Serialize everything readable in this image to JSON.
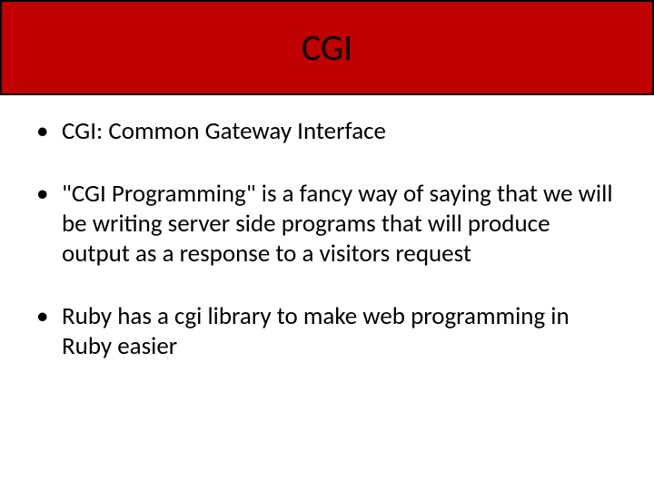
{
  "title": "CGI",
  "bullets": [
    "CGI: Common Gateway Interface",
    "\"CGI Programming\" is a fancy way of saying that we will be writing server side programs that will produce output as a response to a visitors request",
    "Ruby has a cgi library to make web programming in Ruby easier"
  ],
  "bullet_marker": "•"
}
